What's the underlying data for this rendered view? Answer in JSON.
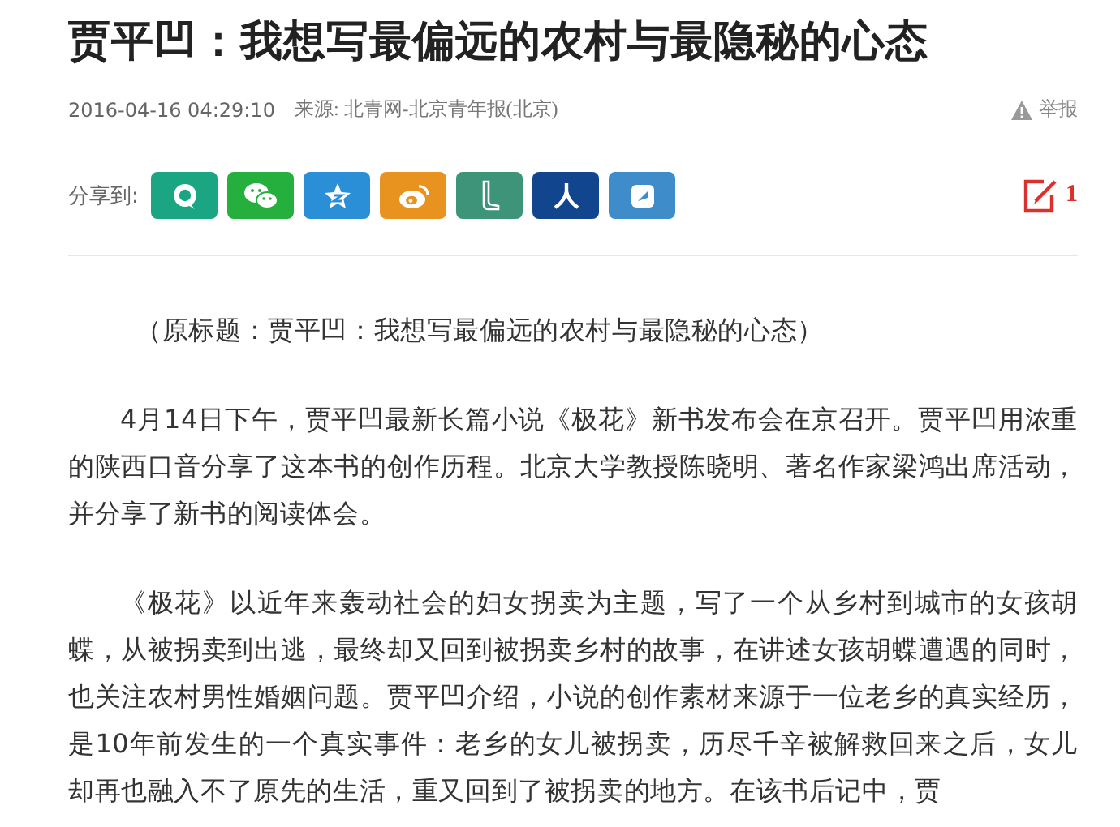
{
  "title": "贾平凹：我想写最偏远的农村与最隐秘的心态",
  "meta": {
    "time": "2016-04-16 04:29:10",
    "source": "来源: 北青网-北京青年报(北京)",
    "report": "举报"
  },
  "share": {
    "label": "分享到:",
    "buttons": [
      {
        "kind": "qq",
        "color": "#1aa683"
      },
      {
        "kind": "wechat",
        "color": "#25b03e"
      },
      {
        "kind": "qzone",
        "color": "#2a8fd6"
      },
      {
        "kind": "weibo",
        "color": "#e8921f"
      },
      {
        "kind": "boot",
        "color": "#3e9478"
      },
      {
        "kind": "person",
        "color": "#11468f"
      },
      {
        "kind": "note",
        "color": "#3f8ccb"
      }
    ]
  },
  "comments": {
    "count": "1"
  },
  "paragraphs": [
    "（原标题：贾平凹：我想写最偏远的农村与最隐秘的心态）",
    "4月14日下午，贾平凹最新长篇小说《极花》新书发布会在京召开。贾平凹用浓重的陕西口音分享了这本书的创作历程。北京大学教授陈晓明、著名作家梁鸿出席活动，并分享了新书的阅读体会。",
    "《极花》以近年来轰动社会的妇女拐卖为主题，写了一个从乡村到城市的女孩胡蝶，从被拐卖到出逃，最终却又回到被拐卖乡村的故事，在讲述女孩胡蝶遭遇的同时，也关注农村男性婚姻问题。贾平凹介绍，小说的创作素材来源于一位老乡的真实经历，是10年前发生的一个真实事件：老乡的女儿被拐卖，历尽千辛被解救回来之后，女儿却再也融入不了原先的生活，重又回到了被拐卖的地方。在该书后记中，贾"
  ]
}
